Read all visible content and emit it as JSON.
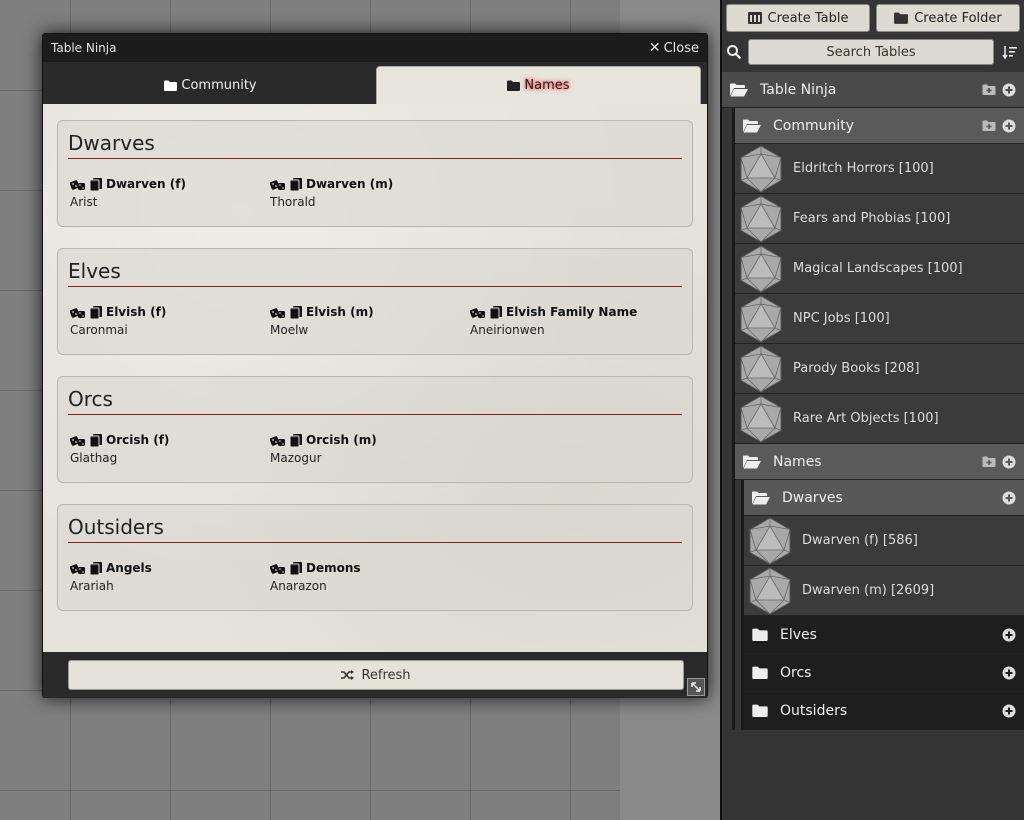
{
  "window": {
    "title": "Table Ninja",
    "close_label": "Close",
    "tabs": [
      {
        "label": "Community",
        "active": false
      },
      {
        "label": "Names",
        "active": true
      }
    ],
    "groups": [
      {
        "title": "Dwarves",
        "items": [
          {
            "name": "Dwarven (f)",
            "value": "Arist"
          },
          {
            "name": "Dwarven (m)",
            "value": "Thorald"
          }
        ]
      },
      {
        "title": "Elves",
        "items": [
          {
            "name": "Elvish (f)",
            "value": "Caronmai"
          },
          {
            "name": "Elvish (m)",
            "value": "Moelw"
          },
          {
            "name": "Elvish Family Name",
            "value": "Aneirionwen"
          }
        ]
      },
      {
        "title": "Orcs",
        "items": [
          {
            "name": "Orcish (f)",
            "value": "Glathag"
          },
          {
            "name": "Orcish (m)",
            "value": "Mazogur"
          }
        ]
      },
      {
        "title": "Outsiders",
        "items": [
          {
            "name": "Angels",
            "value": "Arariah"
          },
          {
            "name": "Demons",
            "value": "Anarazon"
          }
        ]
      }
    ],
    "refresh_label": "Refresh"
  },
  "sidebar": {
    "create_table_label": "Create Table",
    "create_folder_label": "Create Folder",
    "search_placeholder": "Search Tables",
    "root_folder": "Table Ninja",
    "community_folder": "Community",
    "community_tables": [
      "Eldritch Horrors [100]",
      "Fears and Phobias [100]",
      "Magical Landscapes [100]",
      "NPC Jobs [100]",
      "Parody Books [208]",
      "Rare Art Objects [100]"
    ],
    "names_folder": "Names",
    "dwarves_folder": "Dwarves",
    "dwarves_tables": [
      "Dwarven (f) [586]",
      "Dwarven (m) [2609]"
    ],
    "closed_folders": [
      "Elves",
      "Orcs",
      "Outsiders"
    ]
  },
  "colors": {
    "accent_rule": "#8b1e12",
    "tab_glow": "#ff3c3c"
  }
}
